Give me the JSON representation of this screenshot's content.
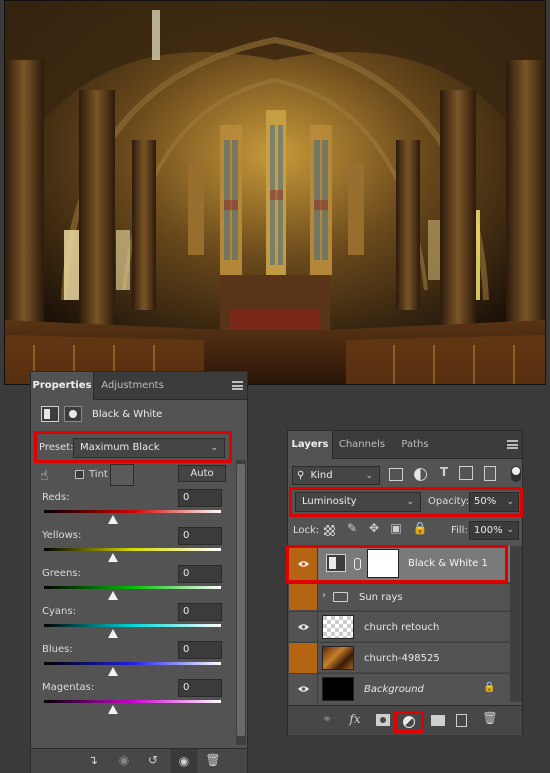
{
  "properties_panel": {
    "tabs": [
      {
        "label": "Properties",
        "active": true
      },
      {
        "label": "Adjustments",
        "active": false
      }
    ],
    "title": "Black & White",
    "preset_label": "Preset:",
    "preset_value": "Maximum Black",
    "tint_label": "Tint",
    "tint_checked": false,
    "auto_label": "Auto",
    "sliders": [
      {
        "label": "Reds:",
        "value": "0",
        "position": 0.39,
        "colors": [
          "#000000",
          "#d10000",
          "#ffffff"
        ]
      },
      {
        "label": "Yellows:",
        "value": "0",
        "position": 0.39,
        "colors": [
          "#000000",
          "#d8d800",
          "#ffffff"
        ]
      },
      {
        "label": "Greens:",
        "value": "0",
        "position": 0.39,
        "colors": [
          "#000000",
          "#00c000",
          "#ffffff"
        ]
      },
      {
        "label": "Cyans:",
        "value": "0",
        "position": 0.39,
        "colors": [
          "#000000",
          "#00d8d8",
          "#ffffff"
        ]
      },
      {
        "label": "Blues:",
        "value": "0",
        "position": 0.39,
        "colors": [
          "#000000",
          "#2020e0",
          "#ffffff"
        ]
      },
      {
        "label": "Magentas:",
        "value": "0",
        "position": 0.39,
        "colors": [
          "#000000",
          "#d000d0",
          "#ffffff"
        ]
      }
    ],
    "footer_icons": [
      "clip-to-layer-icon",
      "view-previous-icon",
      "reset-icon",
      "visibility-icon",
      "trash-icon"
    ]
  },
  "layers_panel": {
    "tabs": [
      {
        "label": "Layers",
        "active": true
      },
      {
        "label": "Channels",
        "active": false
      },
      {
        "label": "Paths",
        "active": false
      }
    ],
    "filter_kind": "Kind",
    "blend_mode": "Luminosity",
    "opacity_label": "Opacity:",
    "opacity_value": "50%",
    "lock_label": "Lock:",
    "fill_label": "Fill:",
    "fill_value": "100%",
    "layers": [
      {
        "name": "Black & White 1",
        "type": "adjustment",
        "visible": true,
        "selected": true
      },
      {
        "name": "Sun rays",
        "type": "group",
        "visible": false,
        "eye_highlight": true
      },
      {
        "name": "church retouch",
        "type": "transparent",
        "visible": true
      },
      {
        "name": "church-498525",
        "type": "photo",
        "visible": false,
        "eye_highlight": true
      },
      {
        "name": "Background",
        "type": "background",
        "visible": true,
        "locked": true
      }
    ],
    "footer_icons": [
      "link-layers-icon",
      "fx-icon",
      "add-mask-icon",
      "adjustment-layer-icon",
      "new-group-icon",
      "new-layer-icon",
      "trash-icon"
    ],
    "fx_label": "fx"
  },
  "colors": {
    "highlight_red": "#e00000",
    "eye_orange": "#b56414",
    "panel_bg": "#535353",
    "app_bg": "#3a3a3a"
  }
}
